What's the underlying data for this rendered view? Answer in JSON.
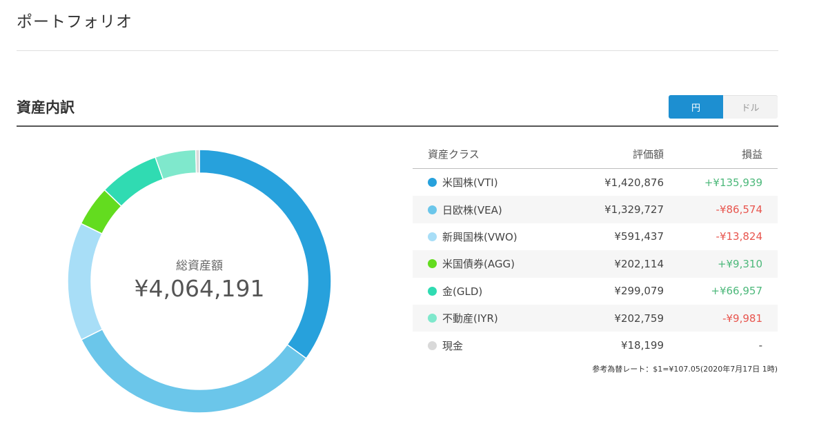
{
  "header": {
    "title": "ポートフォリオ"
  },
  "section": {
    "title": "資産内訳"
  },
  "currency_toggle": {
    "options": [
      "円",
      "ドル"
    ],
    "selected": "円"
  },
  "donut": {
    "center_label": "総資産額",
    "center_value": "¥4,064,191"
  },
  "table": {
    "columns": [
      "資産クラス",
      "評価額",
      "損益"
    ],
    "rows": [
      {
        "name": "米国株(VTI)",
        "amount": "¥1,420,876",
        "pnl": "+¥135,939",
        "color": "#27a1dc",
        "value": 1420876
      },
      {
        "name": "日欧株(VEA)",
        "amount": "¥1,329,727",
        "pnl": "-¥86,574",
        "color": "#6bc6ea",
        "value": 1329727
      },
      {
        "name": "新興国株(VWO)",
        "amount": "¥591,437",
        "pnl": "-¥13,824",
        "color": "#a8def7",
        "value": 591437
      },
      {
        "name": "米国債券(AGG)",
        "amount": "¥202,114",
        "pnl": "+¥9,310",
        "color": "#63dc1f",
        "value": 202114
      },
      {
        "name": "金(GLD)",
        "amount": "¥299,079",
        "pnl": "+¥66,957",
        "color": "#30dbb2",
        "value": 299079
      },
      {
        "name": "不動産(IYR)",
        "amount": "¥202,759",
        "pnl": "-¥9,981",
        "color": "#7fe8cc",
        "value": 202759
      },
      {
        "name": "現金",
        "amount": "¥18,199",
        "pnl": "-",
        "color": "#d9d9d9",
        "value": 18199
      }
    ]
  },
  "note": "参考為替レート：$1=¥107.05(2020年7月17日 1時)"
}
